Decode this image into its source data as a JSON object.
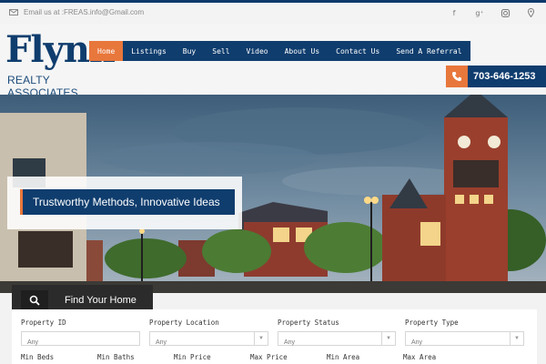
{
  "topbar": {
    "email_text": "Email us at :FREAS.info@Gmail.com",
    "social_icons": [
      "facebook-icon",
      "google-plus-icon",
      "instagram-icon",
      "map-pin-icon"
    ]
  },
  "logo": {
    "main": "Flynn",
    "sub": "REALTY ASSOCIATES"
  },
  "nav": {
    "items": [
      {
        "label": "Home",
        "active": true
      },
      {
        "label": "Listings",
        "active": false
      },
      {
        "label": "Buy",
        "active": false
      },
      {
        "label": "Sell",
        "active": false
      },
      {
        "label": "Video",
        "active": false
      },
      {
        "label": "About Us",
        "active": false
      },
      {
        "label": "Contact Us",
        "active": false
      },
      {
        "label": "Send A Referral",
        "active": false
      }
    ]
  },
  "phone": {
    "number": "703-646-1253",
    "icon": "phone-icon"
  },
  "hero": {
    "tagline": "Trustworthy Methods, Innovative Ideas"
  },
  "search": {
    "tab_label": "Find Your Home",
    "tab_icon": "search-icon",
    "fields_row1": [
      {
        "label": "Property ID",
        "placeholder": "Any",
        "type": "text"
      },
      {
        "label": "Property Location",
        "value": "Any",
        "type": "select"
      },
      {
        "label": "Property Status",
        "value": "Any",
        "type": "select"
      },
      {
        "label": "Property Type",
        "value": "Any",
        "type": "select"
      }
    ],
    "fields_row2": [
      {
        "label": "Min Beds"
      },
      {
        "label": "Min Baths"
      },
      {
        "label": "Min Price"
      },
      {
        "label": "Max Price"
      },
      {
        "label": "Min Area"
      },
      {
        "label": "Max Area"
      }
    ]
  },
  "colors": {
    "brand_blue": "#0f3d6e",
    "accent_orange": "#e8773c"
  }
}
